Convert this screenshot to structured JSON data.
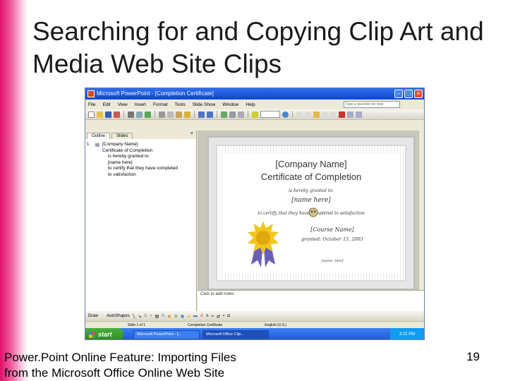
{
  "slide": {
    "title": "Searching for and Copying Clip Art and Media Web Site Clips",
    "footer": "Power.Point Online Feature: Importing Files from the Microsoft Office Online Web Site",
    "page_number": "19",
    "accent_color": "#e0106a"
  },
  "screenshot": {
    "window_title": "Microsoft PowerPoint - [Completion Certificate]",
    "menu": [
      "File",
      "Edit",
      "View",
      "Insert",
      "Format",
      "Tools",
      "Slide Show",
      "Window",
      "Help"
    ],
    "help_placeholder": "Type a question for help",
    "pane_tabs": [
      "Outline",
      "Slides"
    ],
    "outline": {
      "slide_number": "1",
      "lines": [
        "[Company Name]",
        "Certificate of Completion",
        "is hereby granted to:",
        "[name here]",
        "to certify that they have completed",
        "to satisfaction"
      ]
    },
    "certificate": {
      "company": "[Company Name]",
      "heading": "Certificate of Completion",
      "granted": "is hereby granted to:",
      "name": "[name here]",
      "certify": "to certify that they have completed to satisfaction",
      "course": "[Course Name]",
      "date": "granted: October 15, 2003",
      "signature": "[name, title]"
    },
    "notes_placeholder": "Click to add notes",
    "draw_toolbar": {
      "draw": "Draw",
      "autoshapes": "AutoShapes"
    },
    "status": [
      "Slide 1 of 1",
      "Completion Certificate",
      "English (U.S.)"
    ],
    "taskbar": {
      "start": "start",
      "items": [
        "Microsoft PowerPoint - [...",
        "Microsoft Office Clip..."
      ],
      "clock": "3:22 PM"
    }
  }
}
